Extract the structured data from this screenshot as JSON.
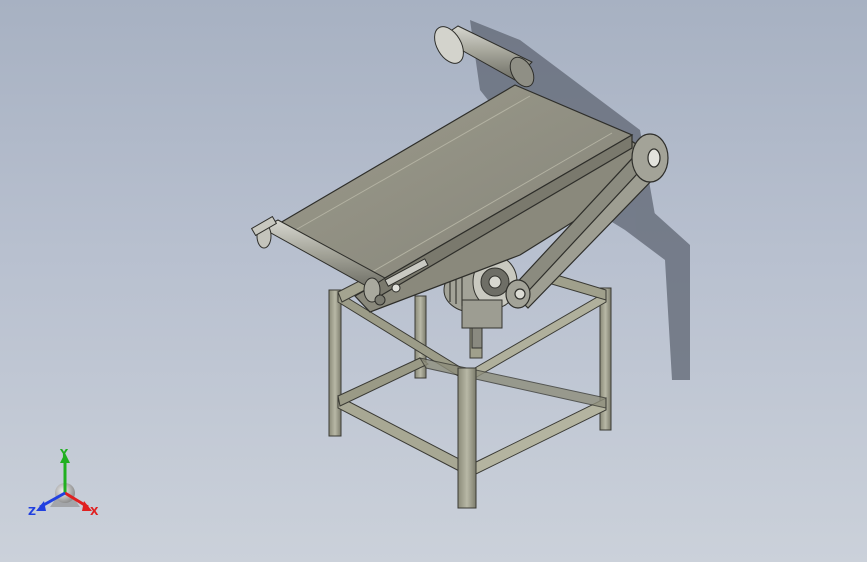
{
  "viewport": {
    "background_top": "#a7b1c2",
    "background_bottom": "#cbd1da"
  },
  "model": {
    "frame_color": "#a8a894",
    "belt_color": "#8e8d7d",
    "shadow_color": "#5f6673",
    "motor_color": "#b9b9b0"
  },
  "triad": {
    "x_label": "X",
    "y_label": "Y",
    "z_label": "Z",
    "x_color": "#e02020",
    "y_color": "#20b020",
    "z_color": "#2040e0"
  }
}
